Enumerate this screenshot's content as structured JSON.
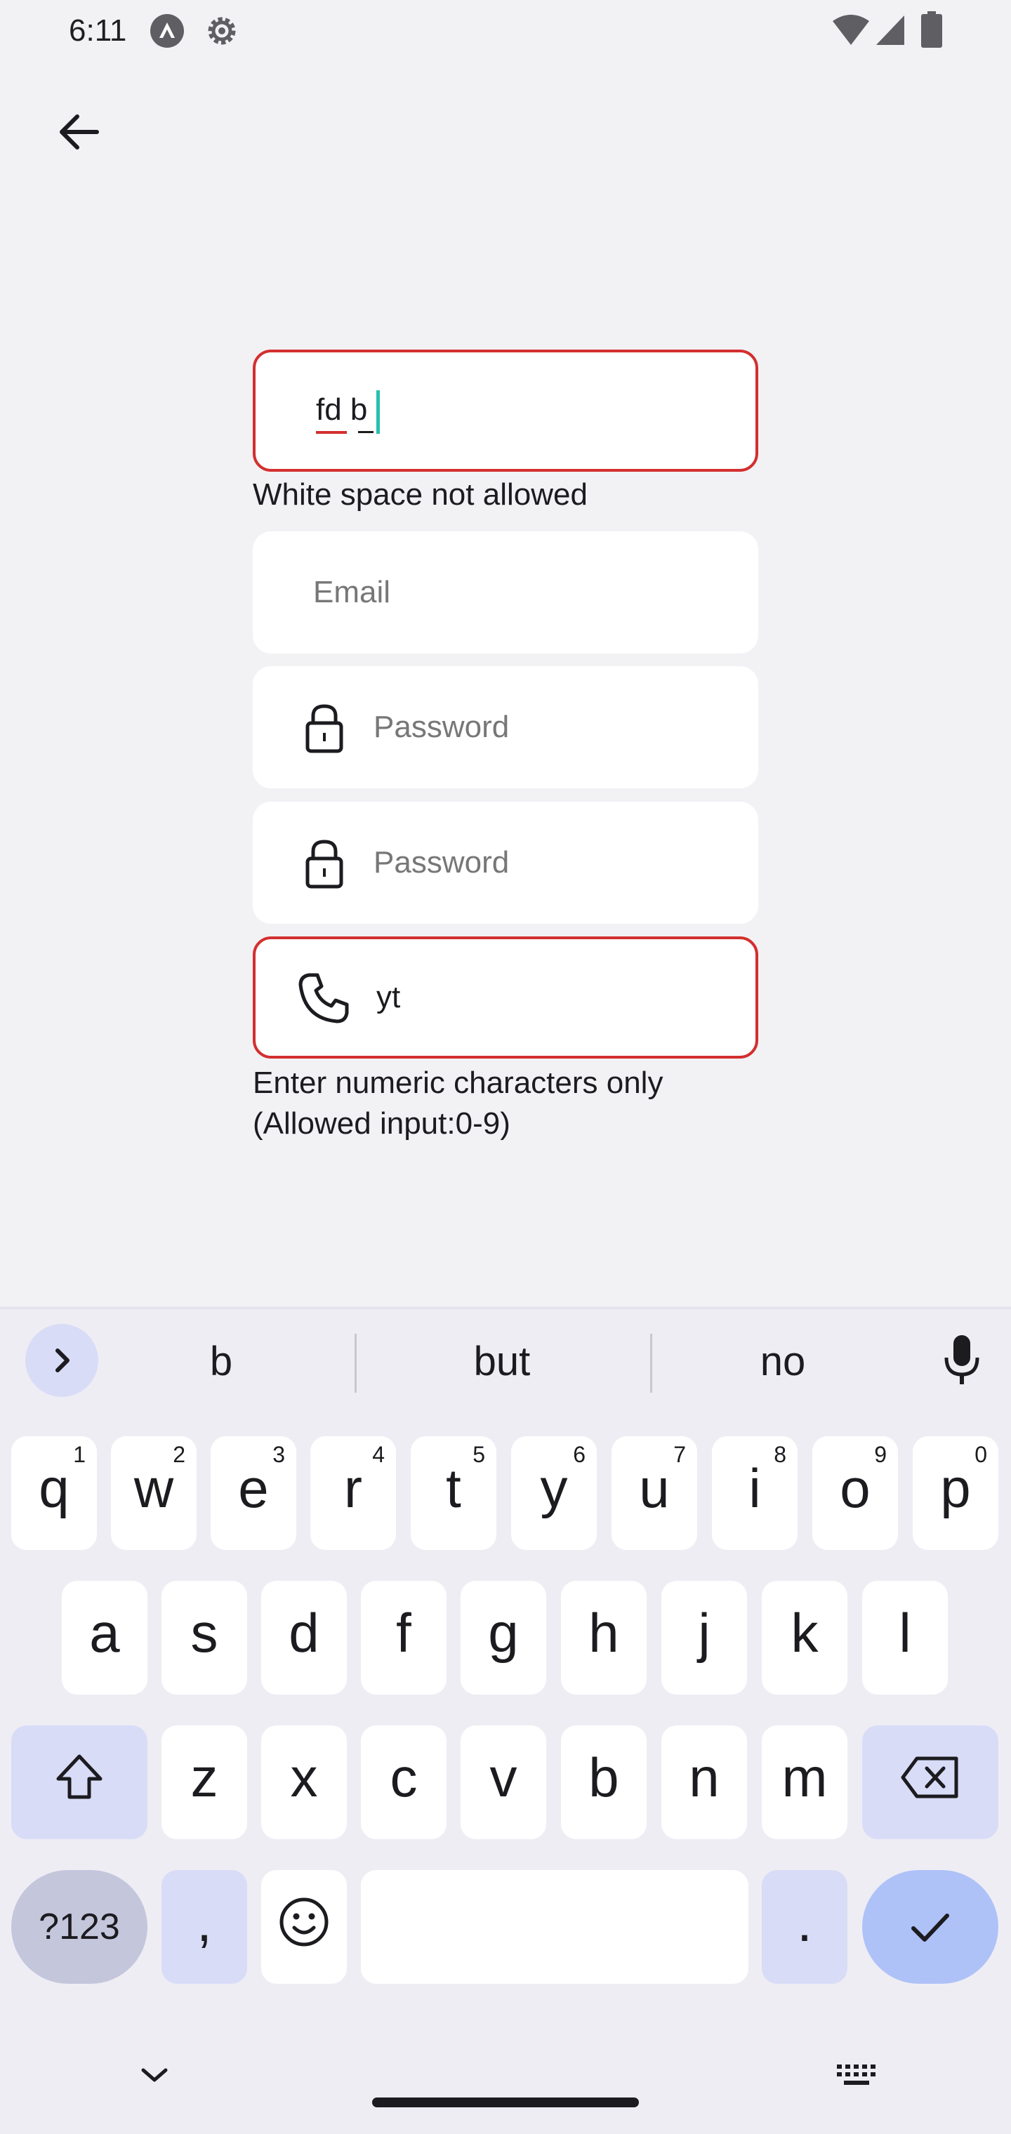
{
  "status_bar": {
    "time": "6:11",
    "left_icons": [
      "app-notification-icon",
      "settings-gear-icon"
    ],
    "right_icons": [
      "wifi-icon",
      "cellular-signal-icon",
      "battery-icon"
    ]
  },
  "form": {
    "username": {
      "value": "fd b",
      "error": "White space not allowed"
    },
    "email": {
      "placeholder": "Email"
    },
    "password": {
      "placeholder": "Password"
    },
    "confirm_password": {
      "placeholder": "Password"
    },
    "phone": {
      "value": "yt",
      "error_line1": "Enter numeric characters only",
      "error_line2": "(Allowed input:0-9)"
    }
  },
  "keyboard": {
    "suggestions": [
      "b",
      "but",
      "no"
    ],
    "row1": [
      {
        "key": "q",
        "hint": "1"
      },
      {
        "key": "w",
        "hint": "2"
      },
      {
        "key": "e",
        "hint": "3"
      },
      {
        "key": "r",
        "hint": "4"
      },
      {
        "key": "t",
        "hint": "5"
      },
      {
        "key": "y",
        "hint": "6"
      },
      {
        "key": "u",
        "hint": "7"
      },
      {
        "key": "i",
        "hint": "8"
      },
      {
        "key": "o",
        "hint": "9"
      },
      {
        "key": "p",
        "hint": "0"
      }
    ],
    "row2": [
      "a",
      "s",
      "d",
      "f",
      "g",
      "h",
      "j",
      "k",
      "l"
    ],
    "row3": [
      "z",
      "x",
      "c",
      "v",
      "b",
      "n",
      "m"
    ],
    "symbols_label": "?123",
    "comma_label": ",",
    "period_label": ".",
    "accent_color": "#aec2f8",
    "func_key_color": "#d8dcf7"
  },
  "colors": {
    "error": "#d32f2f",
    "cursor": "#2bbfb0",
    "background": "#f2f1f4"
  }
}
